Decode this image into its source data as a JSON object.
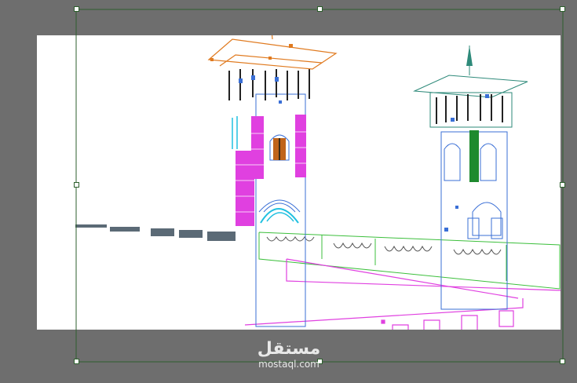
{
  "app": {
    "view": "artboard-canvas",
    "colors": {
      "pasteboard": "#6e6e6e",
      "artboard": "#ffffff",
      "selection": "#2d5f2d",
      "orange_layer": "#e07a1f",
      "blue_layer": "#3a6fd6",
      "magenta_layer": "#e040e0",
      "green_layer": "#3cbf3c",
      "teal_layer": "#2e8a7a",
      "gray_layer": "#5b6a76"
    }
  },
  "selection": {
    "handles": 8,
    "state": "selected"
  },
  "watermark": {
    "arabic_text": "مستقل",
    "latin_text": "mostaql.com"
  },
  "icons": {
    "handle": "square-handle-icon"
  }
}
